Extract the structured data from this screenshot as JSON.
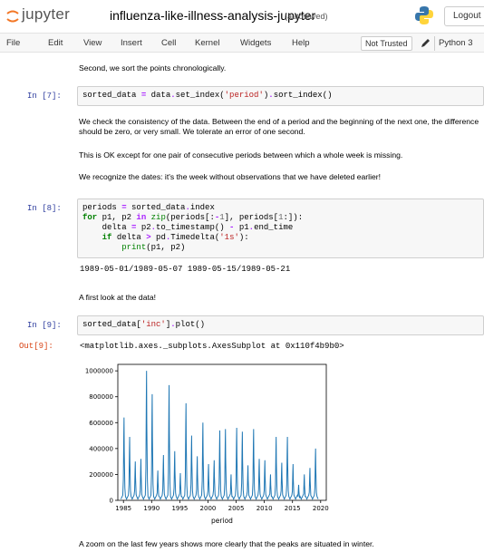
{
  "header": {
    "logo_text": "jupyter",
    "notebook_title": "influenza-like-illness-analysis-jupyter",
    "autosaved": "(autosaved)",
    "logout_label": "Logout"
  },
  "menubar": {
    "items": [
      "File",
      "Edit",
      "View",
      "Insert",
      "Cell",
      "Kernel",
      "Widgets",
      "Help"
    ],
    "not_trusted": "Not Trusted",
    "kernel": "Python 3"
  },
  "cells": {
    "md1": "Second, we sort the points chronologically.",
    "in7_prompt": "In [7]:",
    "md2a": "We check the consistency of the data. Between the end of a period and the beginning of the next one, the difference should be zero, or very small. We tolerate an error of one second.",
    "md2b": "This is OK except for one pair of consecutive periods between which a whole week is missing.",
    "md2c": "We recognize the dates: it's the week without observations that we have deleted earlier!",
    "in8_prompt": "In [8]:",
    "out8": "1989-05-01/1989-05-07 1989-05-15/1989-05-21",
    "md3": "A first look at the data!",
    "in9_prompt": "In [9]:",
    "out9_prompt": "Out[9]:",
    "out9": "<matplotlib.axes._subplots.AxesSubplot at 0x110f4b9b0>",
    "md4": "A zoom on the last few years shows more clearly that the peaks are situated in winter."
  },
  "chart_data": {
    "type": "line",
    "xlabel": "period",
    "ylabel": "",
    "xlim": [
      1984,
      2021
    ],
    "ylim": [
      0,
      1050000
    ],
    "x_ticks": [
      "1985",
      "1990",
      "1995",
      "2000",
      "2005",
      "2010",
      "2015",
      "2020"
    ],
    "y_ticks": [
      "0",
      "200000",
      "400000",
      "600000",
      "800000",
      "1000000"
    ],
    "peak_years": [
      1985.1,
      1986.1,
      1987.1,
      1988.1,
      1989.1,
      1990.1,
      1991.1,
      1992.1,
      1993.1,
      1994.1,
      1995.1,
      1996.1,
      1997.1,
      1998.1,
      1999.1,
      2000.1,
      2001.1,
      2002.1,
      2003.1,
      2004.1,
      2005.1,
      2006.1,
      2007.1,
      2008.1,
      2009.1,
      2010.1,
      2011.1,
      2012.1,
      2013.1,
      2014.1,
      2015.1,
      2016.1,
      2017.1,
      2018.1,
      2019.1
    ],
    "peak_values": [
      640000,
      490000,
      300000,
      320000,
      1000000,
      820000,
      230000,
      350000,
      890000,
      380000,
      210000,
      750000,
      500000,
      340000,
      600000,
      280000,
      310000,
      540000,
      550000,
      200000,
      560000,
      530000,
      270000,
      550000,
      320000,
      310000,
      200000,
      490000,
      290000,
      490000,
      280000,
      120000,
      200000,
      250000,
      400000
    ],
    "baseline": 10000,
    "color": "#1f77b4"
  }
}
